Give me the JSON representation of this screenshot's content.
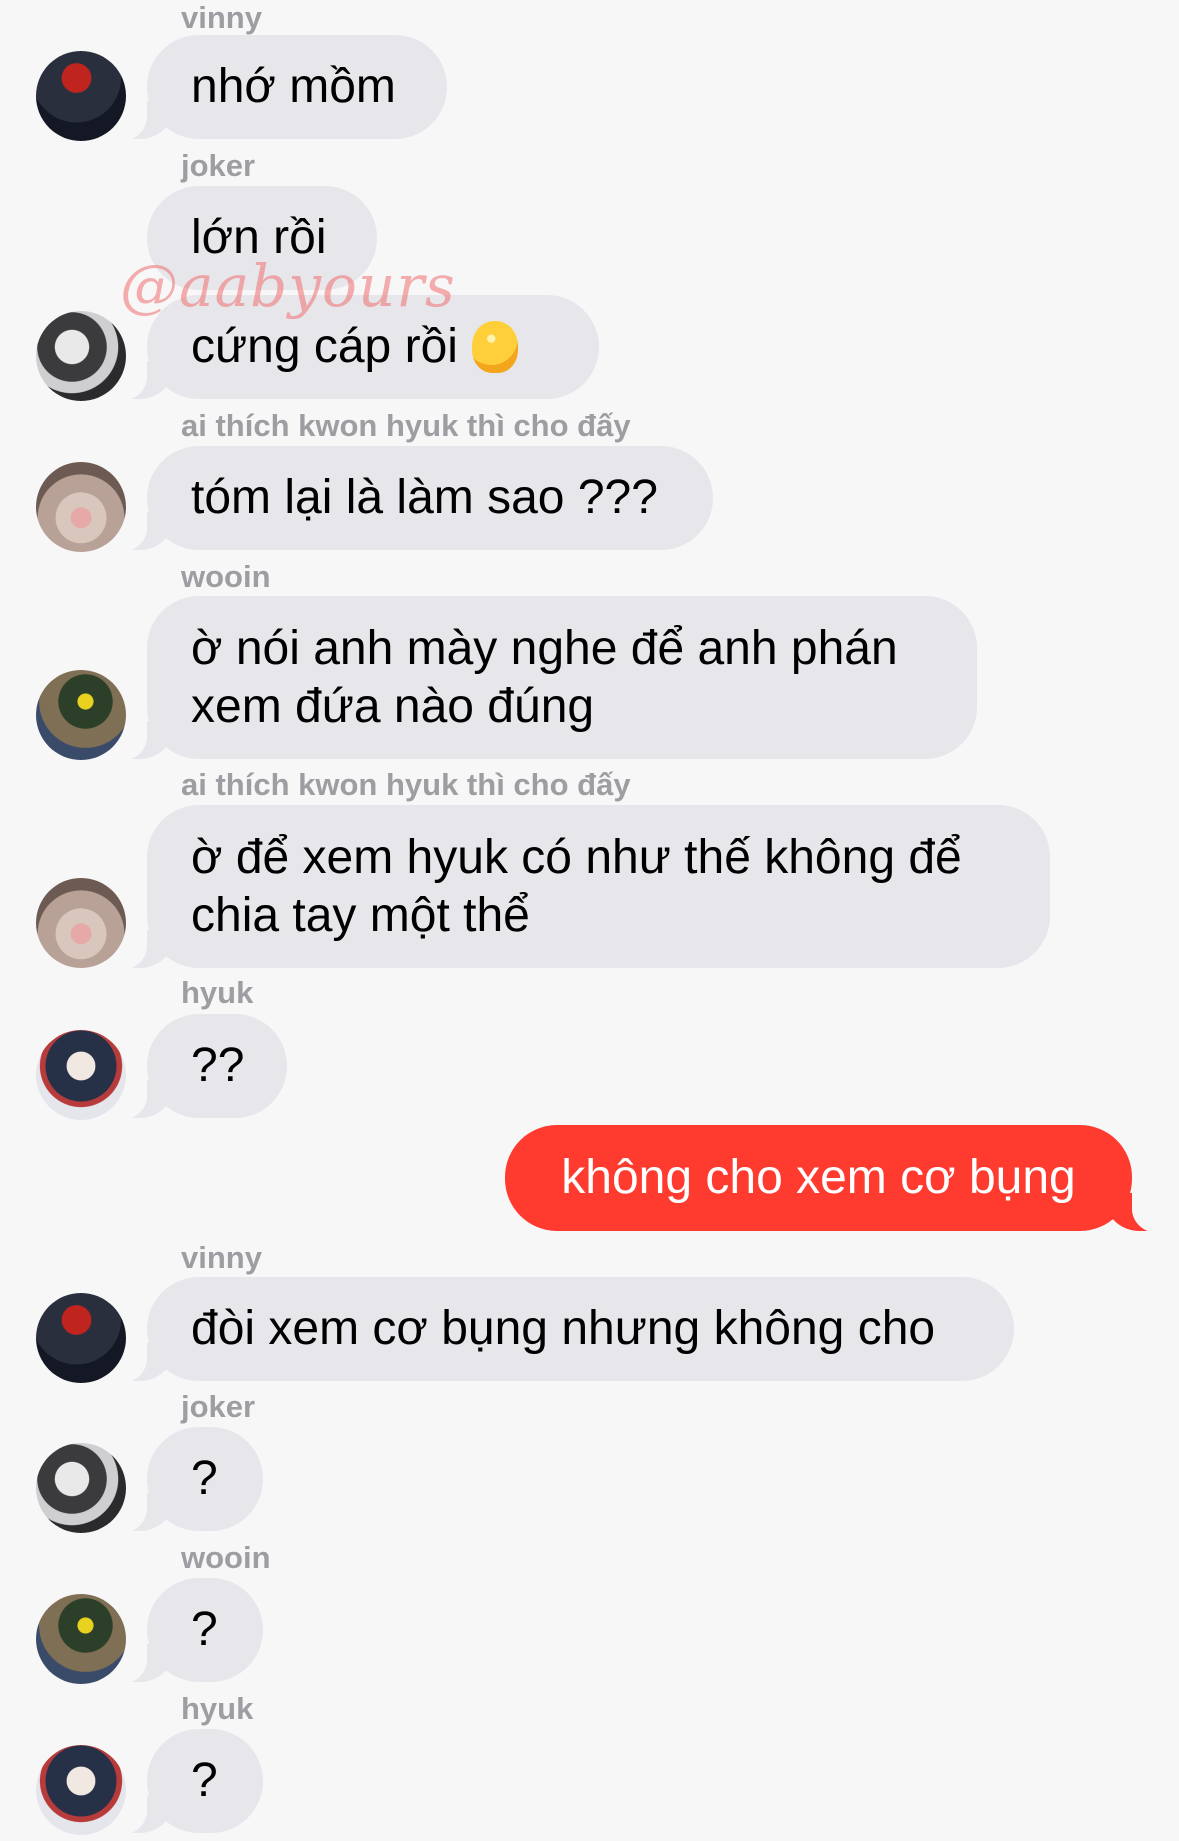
{
  "watermark": "@aabyours",
  "messages": [
    {
      "sender": "vinny",
      "text": "nhớ mồm"
    },
    {
      "sender": "joker",
      "text": "lớn rồi"
    },
    {
      "text": "cứng cáp rồi",
      "icon": "ok-hand-icon"
    },
    {
      "sender": "ai thích kwon hyuk thì cho đấy",
      "text": "tóm lại là làm sao ???"
    },
    {
      "sender": "wooin",
      "text": "ờ nói anh mày nghe để anh phán\nxem đứa nào đúng"
    },
    {
      "sender": "ai thích kwon hyuk thì cho đấy",
      "text": "ờ để xem hyuk có như thế không để\nchia tay một thể"
    },
    {
      "sender": "hyuk",
      "text": "??"
    },
    {
      "text": "không cho xem cơ bụng"
    },
    {
      "sender": "vinny",
      "text": "đòi xem cơ bụng nhưng không cho"
    },
    {
      "sender": "joker",
      "text": "?"
    },
    {
      "sender": "wooin",
      "text": "?"
    },
    {
      "sender": "hyuk",
      "text": "?"
    }
  ],
  "colors": {
    "outgoing": "#ff3b30",
    "incoming": "#e6e6eb",
    "sender": "#9d9da2"
  }
}
